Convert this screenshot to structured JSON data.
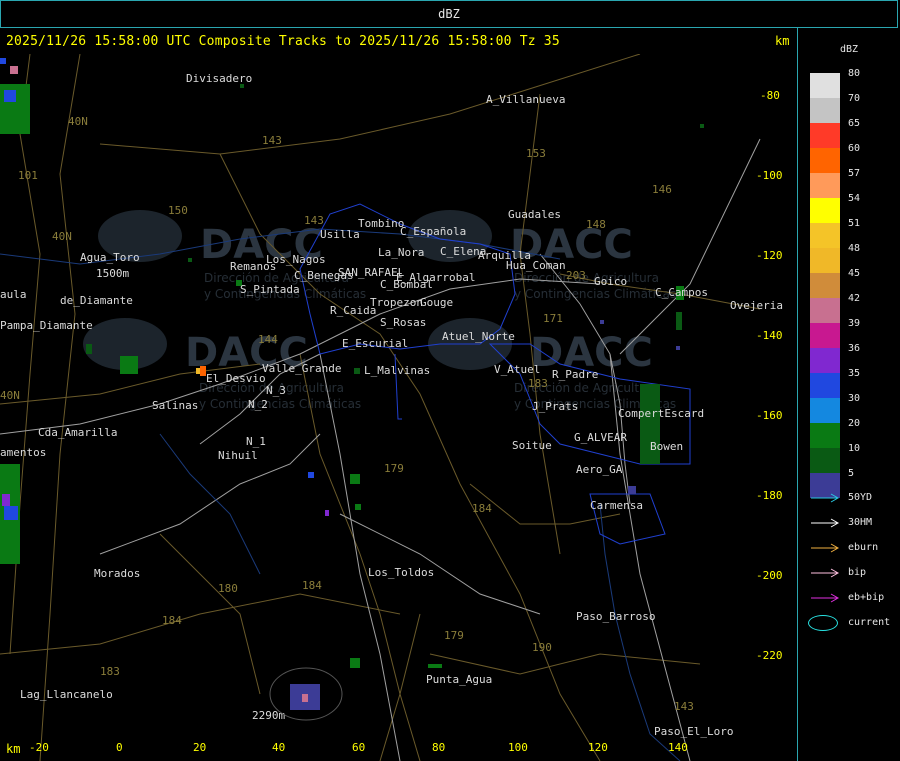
{
  "window": {
    "title": "dBZ"
  },
  "header": {
    "text": "2025/11/26 15:58:00 UTC Composite Tracks to 2025/11/26 15:58:00 Tz 35",
    "km_top": "km",
    "km_bottom": "km"
  },
  "axes": {
    "x_ticks": [
      "-20",
      "0",
      "20",
      "40",
      "60",
      "80",
      "100",
      "120",
      "140"
    ],
    "y_ticks": [
      "-80",
      "-100",
      "-120",
      "-140",
      "-160",
      "-180",
      "-200",
      "-220"
    ]
  },
  "places": [
    {
      "name": "Divisadero"
    },
    {
      "name": "A_Villanueva"
    },
    {
      "name": "Guadales"
    },
    {
      "name": "Tombino"
    },
    {
      "name": "Usilla"
    },
    {
      "name": "C_Española"
    },
    {
      "name": "La_Nora"
    },
    {
      "name": "C_Elena"
    },
    {
      "name": "Arquilla"
    },
    {
      "name": "Agua_Toro"
    },
    {
      "name": "Remanos"
    },
    {
      "name": "1500m"
    },
    {
      "name": "Los_Nagos"
    },
    {
      "name": "SAN_RAFAEL"
    },
    {
      "name": "C_Benegas"
    },
    {
      "name": "E_Algarrobal"
    },
    {
      "name": "C_Bombal"
    },
    {
      "name": "Goico"
    },
    {
      "name": "C_Campos"
    },
    {
      "name": "Ovejeria"
    },
    {
      "name": "aula"
    },
    {
      "name": "de_Diamante"
    },
    {
      "name": "S_Pintada"
    },
    {
      "name": "Tropezon"
    },
    {
      "name": "Gouge"
    },
    {
      "name": "R_Caida"
    },
    {
      "name": "S_Rosas"
    },
    {
      "name": "Pampa_Diamante"
    },
    {
      "name": "Atuel_Norte"
    },
    {
      "name": "E_Escurial"
    },
    {
      "name": "El_Desvio"
    },
    {
      "name": "Valle_Grande"
    },
    {
      "name": "L_Malvinas"
    },
    {
      "name": "V_Atuel"
    },
    {
      "name": "R_Padre"
    },
    {
      "name": "Salinas"
    },
    {
      "name": "N_2"
    },
    {
      "name": "N_3"
    },
    {
      "name": "J_Prats"
    },
    {
      "name": "CompertEscard"
    },
    {
      "name": "Cda_Amarilla"
    },
    {
      "name": "N_1"
    },
    {
      "name": "G_ALVEAR"
    },
    {
      "name": "Bowen"
    },
    {
      "name": "amentos"
    },
    {
      "name": "Nihuil"
    },
    {
      "name": "Soitue"
    },
    {
      "name": "Aero_GA"
    },
    {
      "name": "Carmensa"
    },
    {
      "name": "Morados"
    },
    {
      "name": "Los_Toldos"
    },
    {
      "name": "Paso_Barroso"
    },
    {
      "name": "Punta_Agua"
    },
    {
      "name": "Lag_Llancanelo"
    },
    {
      "name": "2290m"
    },
    {
      "name": "Paso_El_Loro"
    },
    {
      "name": "Hua_Coman"
    }
  ],
  "roads": [
    "40N",
    "101",
    "143",
    "150",
    "153",
    "146",
    "148",
    "144",
    "40N",
    "143",
    "203",
    "171",
    "183",
    "179",
    "184",
    "180",
    "184",
    "179",
    "190",
    "183",
    "184",
    "40N",
    "143"
  ],
  "watermark": {
    "logo": "DACC",
    "line1": "Dirección de Agricultura",
    "line2": "y Contingencias Climáticas"
  },
  "legend": {
    "title": "dBZ",
    "levels": [
      {
        "value": "80",
        "color": "#e0e0e0"
      },
      {
        "value": "70",
        "color": "#c4c4c4"
      },
      {
        "value": "65",
        "color": "#ff3a28"
      },
      {
        "value": "60",
        "color": "#ff6400"
      },
      {
        "value": "57",
        "color": "#ff9a5a"
      },
      {
        "value": "54",
        "color": "#ffff00"
      },
      {
        "value": "51",
        "color": "#f4c428"
      },
      {
        "value": "48",
        "color": "#f0b828"
      },
      {
        "value": "45",
        "color": "#d08c3a"
      },
      {
        "value": "42",
        "color": "#c87090"
      },
      {
        "value": "39",
        "color": "#c81890"
      },
      {
        "value": "36",
        "color": "#8028d0"
      },
      {
        "value": "35",
        "color": "#2048e0"
      },
      {
        "value": "30",
        "color": "#1488e0"
      },
      {
        "value": "20",
        "color": "#0a7a14"
      },
      {
        "value": "10",
        "color": "#0a5a14"
      },
      {
        "value": "5",
        "color": "#3c3c96"
      }
    ],
    "tracks": [
      {
        "label": "50YD",
        "color": "#28c8e0"
      },
      {
        "label": "30HM",
        "color": "#ffffff"
      },
      {
        "label": "eburn",
        "color": "#f0b040"
      },
      {
        "label": "bip",
        "color": "#ffc0e0"
      },
      {
        "label": "eb+bip",
        "color": "#e030e0"
      }
    ],
    "current_label": "current",
    "current_color": "#28e0e0"
  }
}
